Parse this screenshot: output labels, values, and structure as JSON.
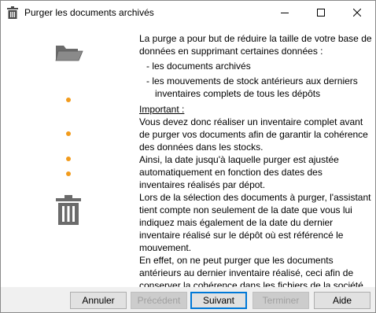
{
  "window": {
    "title": "Purger les documents archivés"
  },
  "content": {
    "intro_1": "La purge a pour but de réduire la taille de votre base de",
    "intro_2": "données en supprimant certaines données :",
    "bullet_1": "- les documents archivés",
    "bullet_2a": "- les mouvements de stock antérieurs aux derniers",
    "bullet_2b": "inventaires complets de tous les dépôts",
    "important": "Important :",
    "p1_1": "Vous devez donc réaliser un inventaire complet avant",
    "p1_2": "de purger vos documents afin de garantir la cohérence",
    "p1_3": "des données dans les stocks.",
    "p2_1": "Ainsi, la date jusqu'à laquelle purger est ajustée",
    "p2_2": "automatiquement  en fonction des dates des",
    "p2_3": "inventaires réalisés par dépot.",
    "p3_1": "Lors de la sélection des documents à purger, l'assistant",
    "p3_2": "tient compte non seulement de la date que vous lui",
    "p3_3": "indiquez mais également de la date du dernier",
    "p3_4": "inventaire réalisé sur le dépôt où est référencé le",
    "p3_5": "mouvement.",
    "p4_1": "En effet, on ne peut purger que les documents",
    "p4_2": "antérieurs au dernier inventaire réalisé, ceci afin de",
    "p4_3": "conserver la cohérence dans les fichiers de la société."
  },
  "buttons": {
    "annuler": "Annuler",
    "precedent": "Précédent",
    "suivant": "Suivant",
    "terminer": "Terminer",
    "aide": "Aide"
  },
  "icons": {
    "title": "trash-icon",
    "folder": "folder-open-icon",
    "trash": "trash-icon",
    "progress_dot": "progress-dot-icon"
  },
  "colors": {
    "dot": "#f29b1c",
    "icon_gray": "#6b6b6b",
    "default_button_border": "#0078d7"
  }
}
